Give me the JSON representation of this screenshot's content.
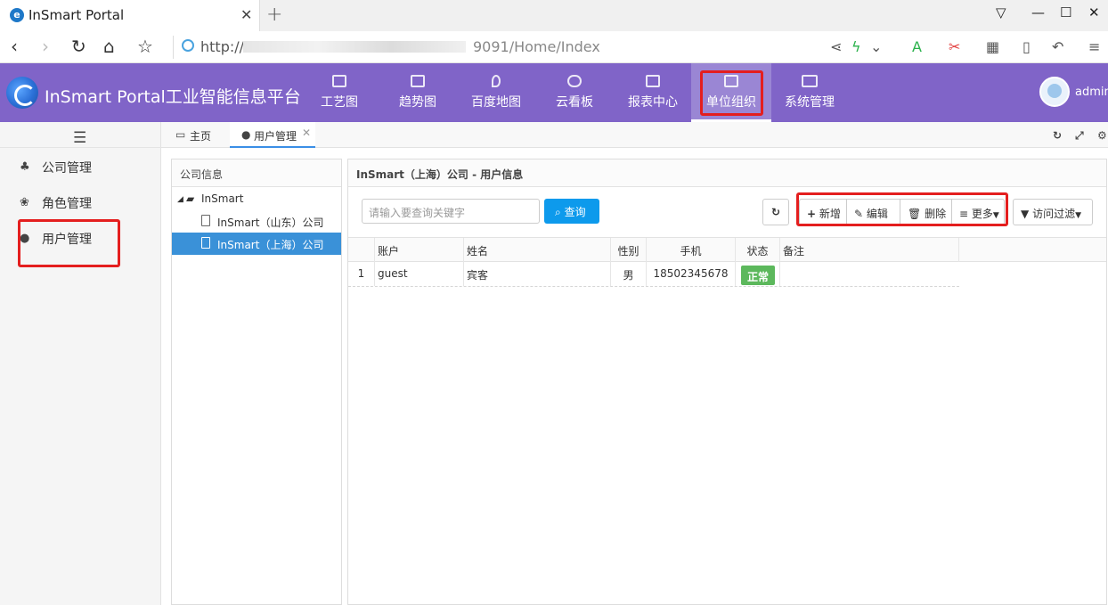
{
  "browser": {
    "tab_title": "InSmart Portal",
    "tab_close": "✕",
    "new_tab": "+",
    "url_scheme": "http://",
    "url_tail": "9091/Home/Index"
  },
  "app": {
    "title": "InSmart Portal工业智能信息平台",
    "username": "admin",
    "menu": [
      {
        "label": "工艺图",
        "icon": "image-icon"
      },
      {
        "label": "趋势图",
        "icon": "area-chart-icon"
      },
      {
        "label": "百度地图",
        "icon": "map-marker-icon"
      },
      {
        "label": "云看板",
        "icon": "cloud-icon"
      },
      {
        "label": "报表中心",
        "icon": "area-chart-icon"
      },
      {
        "label": "单位组织",
        "icon": "coffee-icon"
      },
      {
        "label": "系统管理",
        "icon": "desktop-icon"
      }
    ]
  },
  "sidebar": {
    "items": [
      {
        "label": "公司管理",
        "icon": "sitemap-icon"
      },
      {
        "label": "角色管理",
        "icon": "paw-icon"
      },
      {
        "label": "用户管理",
        "icon": "user-icon"
      }
    ]
  },
  "content_tabs": [
    {
      "label": "主页",
      "icon": "desktop-icon"
    },
    {
      "label": "用户管理",
      "icon": "user-icon"
    }
  ],
  "tree": {
    "header": "公司信息",
    "root": "InSmart",
    "children": [
      "InSmart（山东）公司",
      "InSmart（上海）公司"
    ]
  },
  "users": {
    "header": "InSmart（上海）公司 - 用户信息",
    "search_placeholder": "请输入要查询关键字",
    "search_button": "查询",
    "actions": {
      "add": "新增",
      "edit": "编辑",
      "delete": "删除",
      "more": "更多",
      "filter": "访问过滤"
    },
    "columns": [
      "账户",
      "姓名",
      "性别",
      "手机",
      "状态",
      "备注"
    ],
    "rows": [
      {
        "index": "1",
        "account": "guest",
        "name": "宾客",
        "gender": "男",
        "phone": "18502345678",
        "status": "正常",
        "remark": ""
      }
    ]
  }
}
